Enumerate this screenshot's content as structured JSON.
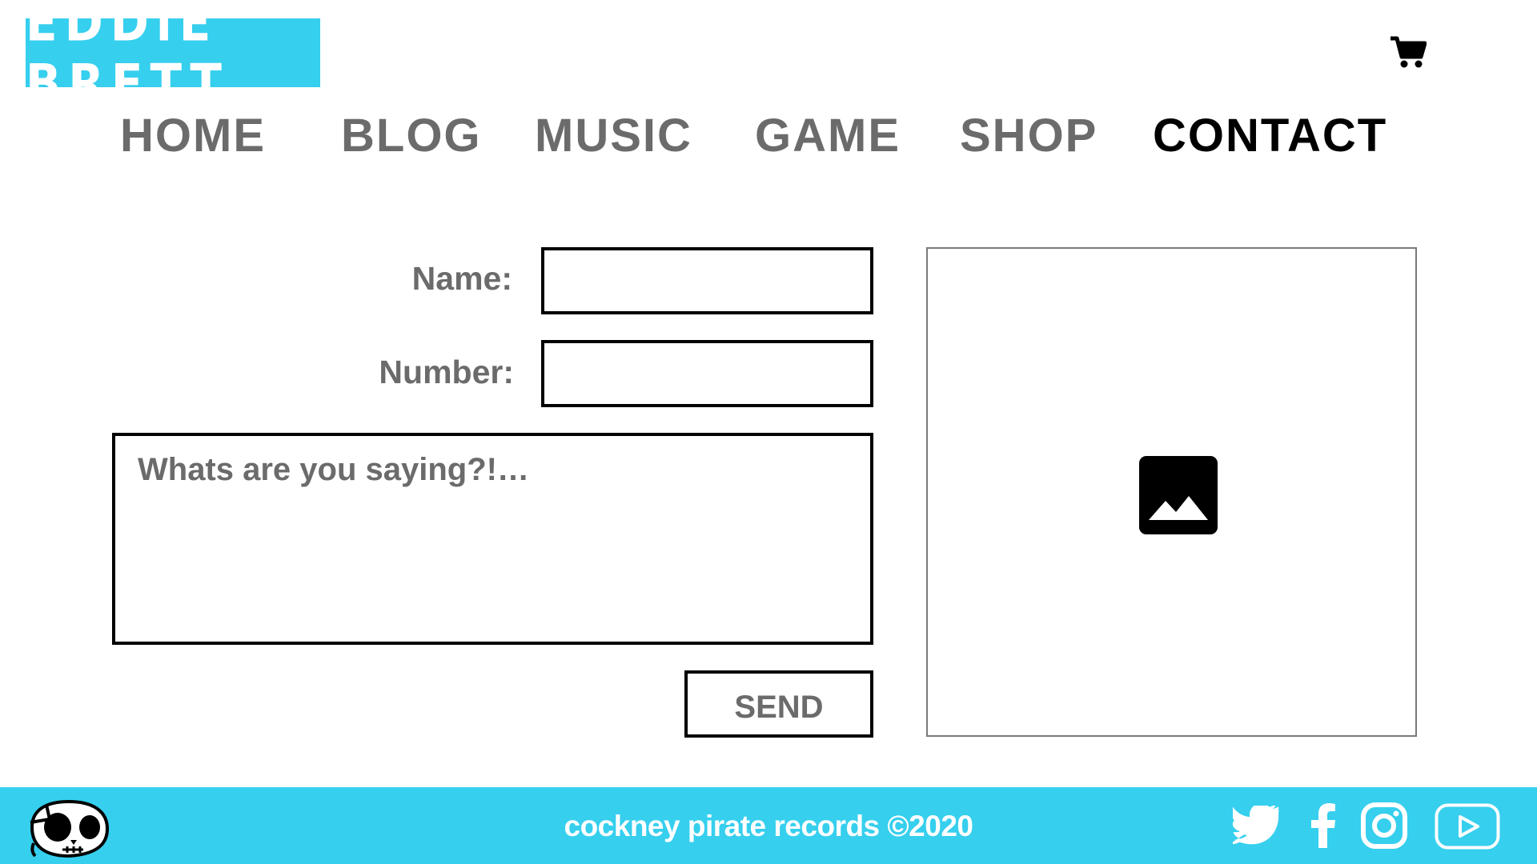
{
  "brand": {
    "logo_text": "EDDiE BRETT",
    "accent_color": "#36cfee"
  },
  "header": {
    "cart_icon": "shopping-cart-icon"
  },
  "nav": {
    "items": [
      {
        "label": "HOME",
        "active": false
      },
      {
        "label": "BLOG",
        "active": false
      },
      {
        "label": "MUSIC",
        "active": false
      },
      {
        "label": "GAME",
        "active": false
      },
      {
        "label": "SHOP",
        "active": false
      },
      {
        "label": "CONTACT",
        "active": true
      }
    ]
  },
  "form": {
    "name_label": "Name:",
    "name_value": "",
    "number_label": "Number:",
    "number_value": "",
    "message_placeholder": "Whats are you saying?!…",
    "send_label": "SEND"
  },
  "media": {
    "placeholder_icon": "image-placeholder-icon"
  },
  "footer": {
    "copyright": "cockney pirate records ©2020",
    "logo_icon": "pirate-skull-icon",
    "social": [
      "twitter-icon",
      "facebook-icon",
      "instagram-icon",
      "youtube-icon"
    ]
  }
}
